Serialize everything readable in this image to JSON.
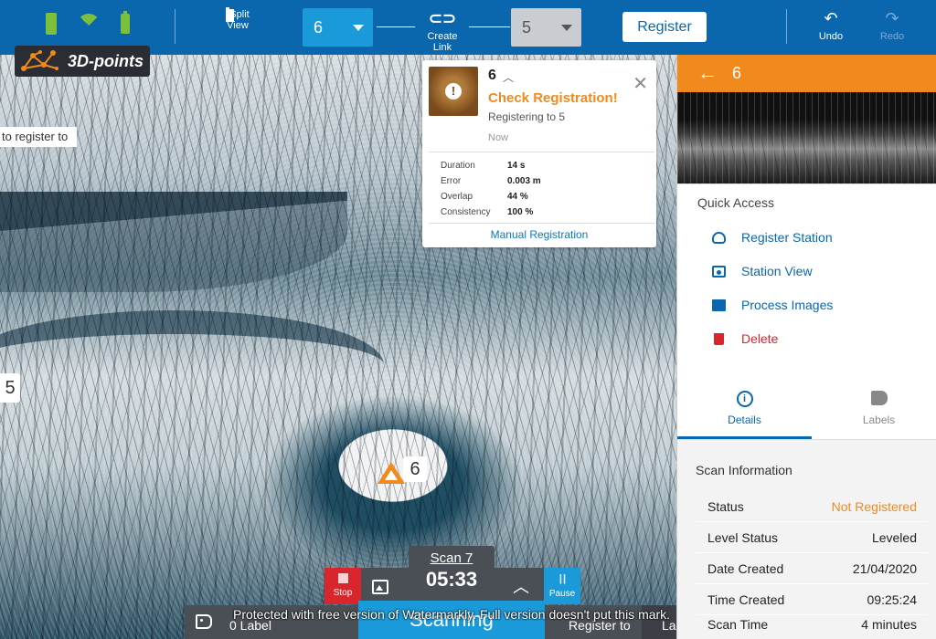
{
  "toolbar": {
    "split_view_label": "Split View",
    "left_station": "6",
    "create_link_label": "Create Link",
    "right_station": "5",
    "register_label": "Register",
    "undo_label": "Undo",
    "redo_label": "Redo"
  },
  "viewport": {
    "logo_text": "3D-points",
    "hint_text": "to register to",
    "station_left_label": "5",
    "station_current_label": "6"
  },
  "registration_card": {
    "station": "6",
    "title": "Check Registration!",
    "subtitle": "Registering to 5",
    "time": "Now",
    "metrics": [
      {
        "label": "Duration",
        "value": "14 s"
      },
      {
        "label": "Error",
        "value": "0.003 m"
      },
      {
        "label": "Overlap",
        "value": "44 %"
      },
      {
        "label": "Consistency",
        "value": "100 %"
      }
    ],
    "manual_label": "Manual Registration"
  },
  "scan_controls": {
    "stop_label": "Stop",
    "pause_label": "Pause",
    "scan_name": "Scan 7",
    "timer": "05:33",
    "label_count": "0 Label",
    "scanning_label": "Scanning",
    "register_to_label": "Register to",
    "register_to_value": "Last"
  },
  "watermark": "Protected with free version of Watermarkly. Full version doesn't put this mark.",
  "right_panel": {
    "station": "6",
    "quick_access_title": "Quick Access",
    "quick_access": [
      {
        "label": "Register Station",
        "icon": "cloud-icon"
      },
      {
        "label": "Station View",
        "icon": "station-view-icon"
      },
      {
        "label": "Process Images",
        "icon": "image-icon"
      },
      {
        "label": "Delete",
        "icon": "trash-icon"
      }
    ],
    "tabs": {
      "details": "Details",
      "labels": "Labels"
    },
    "scan_info_title": "Scan Information",
    "scan_info": [
      {
        "label": "Status",
        "value": "Not Registered"
      },
      {
        "label": "Level Status",
        "value": "Leveled"
      },
      {
        "label": "Date Created",
        "value": "21/04/2020"
      },
      {
        "label": "Time Created",
        "value": "09:25:24"
      },
      {
        "label": "Scan Time",
        "value": "4 minutes"
      }
    ]
  },
  "colors": {
    "toolbar": "#0a66ad",
    "accent_orange": "#f08a1c",
    "accent_blue": "#1a9ad9",
    "stop_red": "#d9252c",
    "status_ok": "#7bbf3a"
  }
}
